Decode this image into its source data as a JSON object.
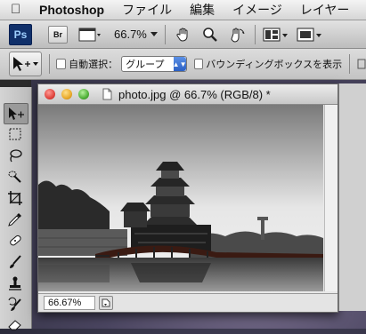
{
  "menubar": {
    "app": "Photoshop",
    "items": [
      "ファイル",
      "編集",
      "イメージ",
      "レイヤー"
    ]
  },
  "appbar": {
    "logo": "Ps",
    "bridge": "Br",
    "zoom": "66.7%"
  },
  "options": {
    "auto_select": "自動選択：",
    "auto_select_value": "グループ",
    "bounding_box": "バウンディングボックスを表示"
  },
  "document": {
    "title": "photo.jpg @ 66.7% (RGB/8) *",
    "zoom": "66.67%"
  },
  "colors": {
    "close": "#e0443e",
    "minimize": "#e9a92b",
    "zoom": "#4fb038"
  }
}
